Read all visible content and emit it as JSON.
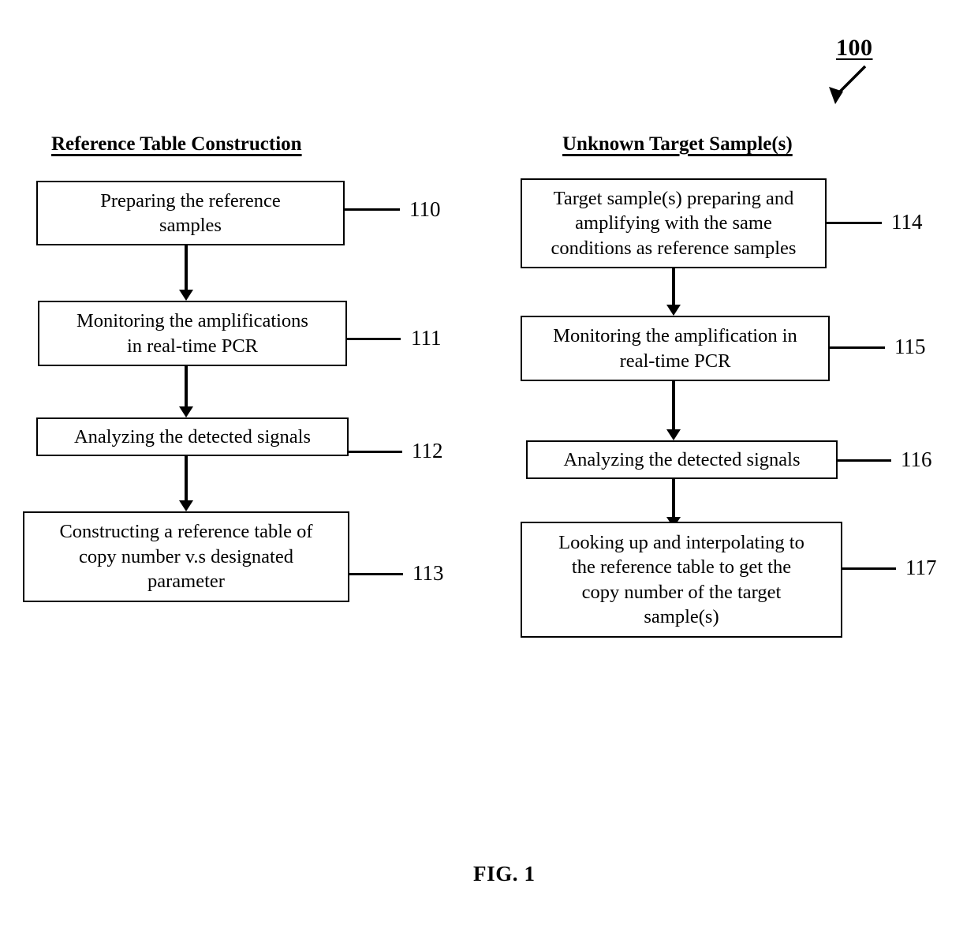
{
  "figure": {
    "number_label": "100",
    "caption": "FIG. 1"
  },
  "columns": [
    {
      "heading": "Reference Table Construction",
      "steps": [
        {
          "ref": "110",
          "text": "Preparing the reference\nsamples"
        },
        {
          "ref": "111",
          "text": "Monitoring the amplifications\nin real-time PCR"
        },
        {
          "ref": "112",
          "text": "Analyzing the detected signals"
        },
        {
          "ref": "113",
          "text": "Constructing a reference table of\ncopy number v.s designated\nparameter"
        }
      ]
    },
    {
      "heading": "Unknown Target Sample(s)",
      "steps": [
        {
          "ref": "114",
          "text": "Target sample(s) preparing and\namplifying with the same\nconditions as reference samples"
        },
        {
          "ref": "115",
          "text": "Monitoring the amplification in\nreal-time PCR"
        },
        {
          "ref": "116",
          "text": "Analyzing the detected signals"
        },
        {
          "ref": "117",
          "text": "Looking up and interpolating to\nthe reference table to get the\ncopy number of the target\nsample(s)"
        }
      ]
    }
  ],
  "colors": {
    "ink": "#000000",
    "paper": "#ffffff"
  }
}
